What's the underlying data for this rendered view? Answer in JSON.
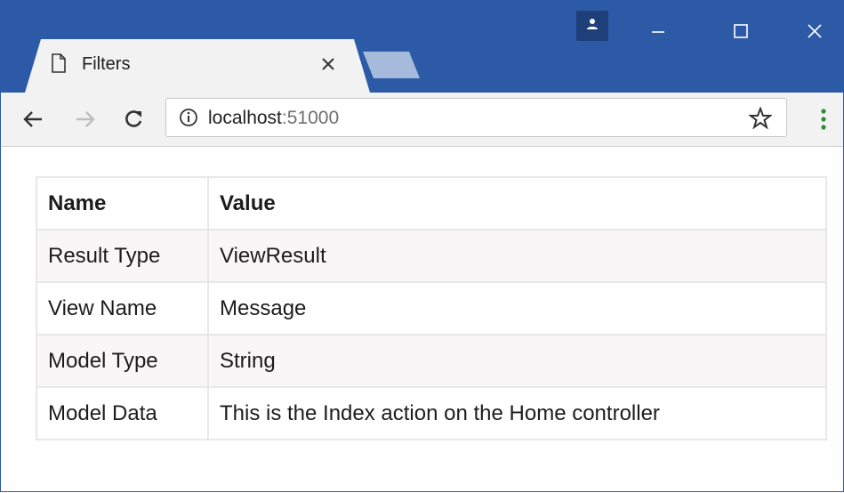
{
  "window": {
    "tab_title": "Filters"
  },
  "toolbar": {
    "url_host": "localhost",
    "url_port": ":51000"
  },
  "table": {
    "headers": [
      "Name",
      "Value"
    ],
    "rows": [
      [
        "Result Type",
        "ViewResult"
      ],
      [
        "View Name",
        "Message"
      ],
      [
        "Model Type",
        "String"
      ],
      [
        "Model Data",
        "This is the Index action on the Home controller"
      ]
    ]
  },
  "colors": {
    "titlebar": "#2c5aa6",
    "toolbar": "#f2f2f2",
    "table_border": "#e8e8e8",
    "row_stripe": "#f8f6f6"
  }
}
